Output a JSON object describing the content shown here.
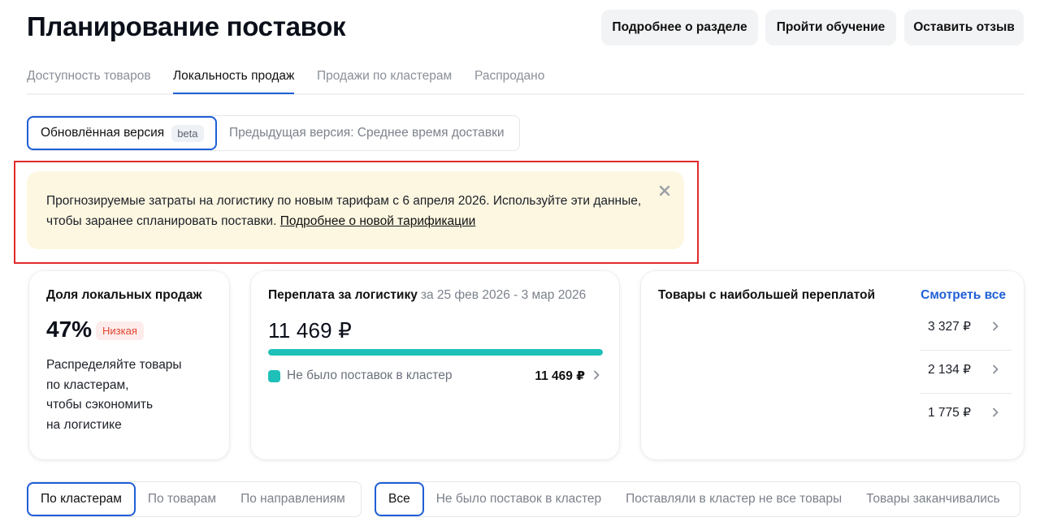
{
  "page": {
    "title": "Планирование поставок"
  },
  "header_buttons": {
    "about": "Подробнее о разделе",
    "training": "Пройти обучение",
    "feedback": "Оставить отзыв"
  },
  "tabs": [
    {
      "label": "Доступность товаров",
      "active": false
    },
    {
      "label": "Локальность продаж",
      "active": true
    },
    {
      "label": "Продажи по кластерам",
      "active": false
    },
    {
      "label": "Распродано",
      "active": false
    }
  ],
  "version_switch": {
    "new_label": "Обновлённая версия",
    "beta": "beta",
    "previous_label": "Предыдущая версия: Среднее время доставки"
  },
  "notice": {
    "text": "Прогнозируемые затраты на логистику по новым тарифам с 6 апреля 2026. Используйте эти данные, чтобы заранее спланировать поставки.",
    "link": "Подробнее о новой тарификации"
  },
  "local_share": {
    "title": "Доля локальных продаж",
    "percent": "47%",
    "level": "Низкая",
    "description_lines": [
      "Распределяйте товары",
      "по кластерам,",
      "чтобы сэкономить",
      "на логистике"
    ]
  },
  "overpayment": {
    "title": "Переплата за логистику",
    "period": "за 25 фев 2026 - 3 мар 2026",
    "amount": "11 469 ₽",
    "progress": 1.0,
    "legend_label": "Не было поставок в кластер",
    "legend_value": "11 469 ₽",
    "color": "#1ec0b8"
  },
  "top_products": {
    "title": "Товары с наибольшей переплатой",
    "see_all": "Смотреть все",
    "items": [
      {
        "price": "3 327 ₽"
      },
      {
        "price": "2 134 ₽"
      },
      {
        "price": "1 775 ₽"
      }
    ]
  },
  "view_switch": [
    "По кластерам",
    "По товарам",
    "По направлениям"
  ],
  "filter_switch": [
    "Все",
    "Не было поставок в кластер",
    "Поставляли в кластер не все товары",
    "Товары заканчивались"
  ],
  "colors": {
    "accent": "#1f5fd6",
    "highlight_border": "#e02a2a",
    "notice_bg": "#fdf7e1",
    "low_badge": "#e3452f"
  }
}
